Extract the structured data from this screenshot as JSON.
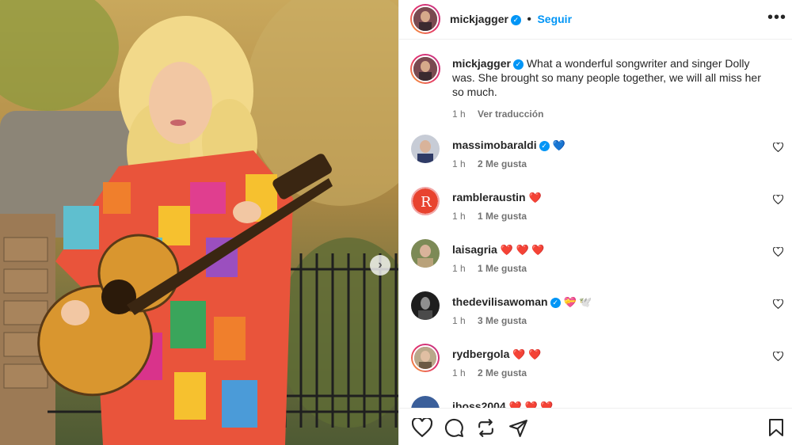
{
  "post": {
    "username": "mickjagger",
    "follow_label": "Seguir",
    "more_label": "•••",
    "next_label": "›"
  },
  "caption": {
    "username": "mickjagger",
    "text": "What a wonderful songwriter and singer Dolly was. She brought so many people together, we will all miss her so much.",
    "time": "1 h",
    "translate": "Ver traducción"
  },
  "comments": [
    {
      "username": "massimobaraldi",
      "verified": true,
      "emoji": "💙",
      "time": "1 h",
      "likes": "2 Me gusta"
    },
    {
      "username": "rambleraustin",
      "verified": false,
      "emoji": "❤️",
      "time": "1 h",
      "likes": "1 Me gusta"
    },
    {
      "username": "laisagria",
      "verified": false,
      "emoji": "❤️ ❤️ ❤️",
      "time": "1 h",
      "likes": "1 Me gusta"
    },
    {
      "username": "thedevilisawoman",
      "verified": true,
      "emoji": "💝 🕊️",
      "time": "1 h",
      "likes": "3 Me gusta"
    },
    {
      "username": "rydbergola",
      "verified": false,
      "emoji": "❤️ ❤️",
      "time": "1 h",
      "likes": "2 Me gusta"
    },
    {
      "username": "jboss2004",
      "verified": false,
      "emoji": "❤️ ❤️ ❤️",
      "time": "",
      "likes": ""
    }
  ],
  "icons": {
    "like": "heart-icon",
    "comment": "comment-icon",
    "share": "repost-icon",
    "send": "send-icon",
    "save": "bookmark-icon"
  },
  "colors": {
    "accent": "#0095f6",
    "text": "#262626",
    "muted": "#737373",
    "like_heart": "#ed4956"
  }
}
